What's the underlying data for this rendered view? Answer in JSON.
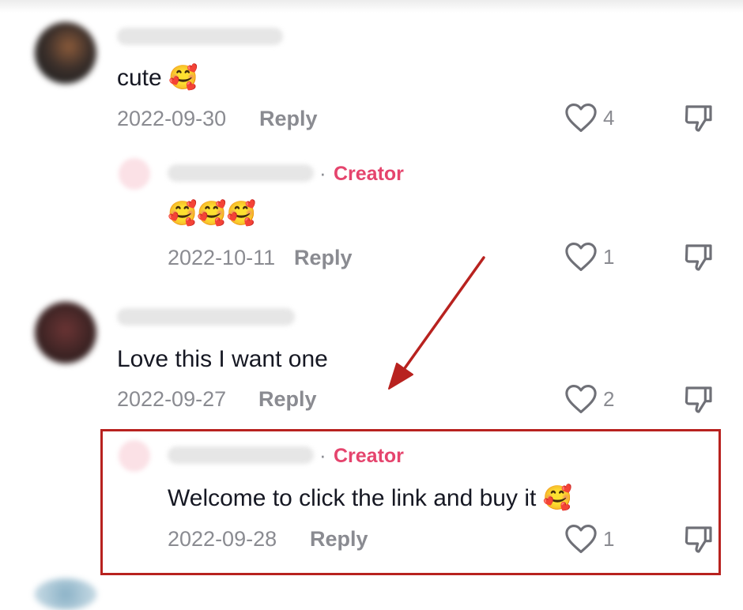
{
  "comments": [
    {
      "text": "cute",
      "emoji": "🥰",
      "date": "2022-09-30",
      "reply_label": "Reply",
      "like_count": "4"
    },
    {
      "badge_sep": "·",
      "badge": "Creator",
      "text": "",
      "emoji": "🥰🥰🥰",
      "date": "2022-10-11",
      "reply_label": "Reply",
      "like_count": "1"
    },
    {
      "text": "Love this I want one",
      "date": "2022-09-27",
      "reply_label": "Reply",
      "like_count": "2"
    },
    {
      "badge_sep": "·",
      "badge": "Creator",
      "text": "Welcome to click the link and buy it",
      "emoji": "🥰",
      "date": "2022-09-28",
      "reply_label": "Reply",
      "like_count": "1"
    }
  ],
  "icons": {
    "like": "heart-outline-icon",
    "dislike": "thumbs-down-icon"
  },
  "colors": {
    "creator_badge": "#e5446d",
    "meta_text": "#8a8b91",
    "annotation": "#b8221f"
  }
}
